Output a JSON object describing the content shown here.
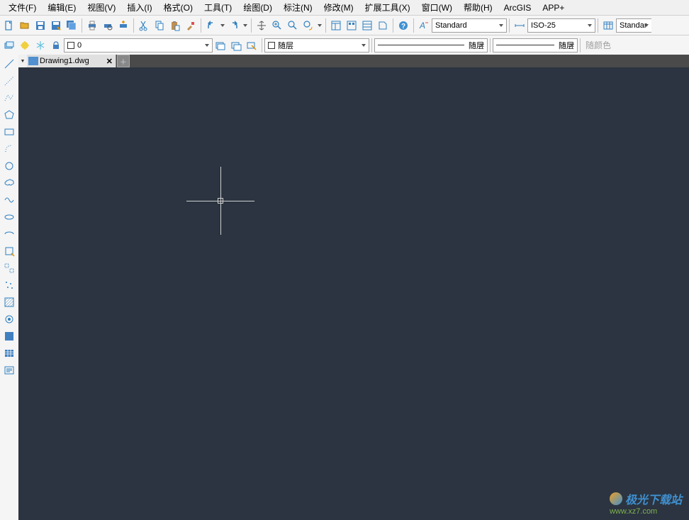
{
  "menu": {
    "file": "文件(F)",
    "edit": "编辑(E)",
    "view": "视图(V)",
    "insert": "插入(I)",
    "format": "格式(O)",
    "tools": "工具(T)",
    "draw": "绘图(D)",
    "annotate": "标注(N)",
    "modify": "修改(M)",
    "ext": "扩展工具(X)",
    "window": "窗口(W)",
    "help": "帮助(H)",
    "arcgis": "ArcGIS",
    "app": "APP+"
  },
  "toolbar1": {
    "text_style": "Standard",
    "dim_style": "ISO-25",
    "table_style": "Standar"
  },
  "toolbar2": {
    "layer": "0",
    "color_label": "随层",
    "linetype_label": "随层",
    "lineweight_label": "随层",
    "bycolor": "随颜色"
  },
  "tabs": {
    "active": "Drawing1.dwg"
  },
  "watermark": {
    "title": "极光下载站",
    "url": "www.xz7.com"
  }
}
